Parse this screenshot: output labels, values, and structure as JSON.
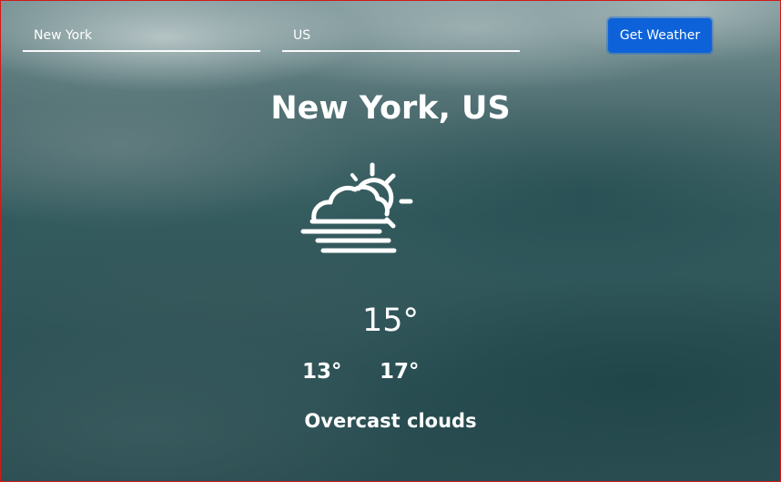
{
  "search": {
    "city_value": "New York",
    "country_value": "US",
    "button_label": "Get Weather"
  },
  "weather": {
    "location": "New York, US",
    "icon": "partly-cloudy-fog-icon",
    "temperature": "15°",
    "temp_min": "13°",
    "temp_max": "17°",
    "description": "Overcast clouds"
  },
  "colors": {
    "button": "#0d62d9",
    "text": "#ffffff",
    "border": "#d11a1a"
  }
}
